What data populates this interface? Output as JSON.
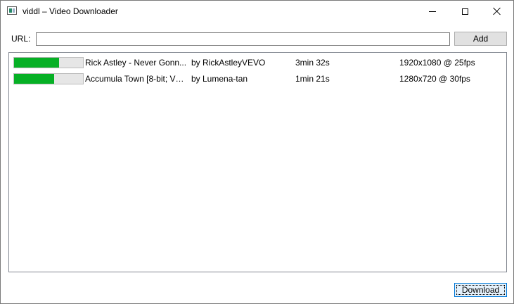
{
  "window": {
    "title": "viddl – Video Downloader",
    "icon": "app-window-icon"
  },
  "caption_buttons": {
    "minimize_icon": "minimize-icon",
    "maximize_icon": "maximize-icon",
    "close_icon": "close-icon"
  },
  "url_row": {
    "label": "URL:",
    "input_value": "",
    "input_placeholder": "",
    "add_label": "Add"
  },
  "videos": [
    {
      "title": "Rick Astley - Never Gonn...",
      "author": "by RickAstleyVEVO",
      "duration": "3min 32s",
      "format": "1920x1080 @ 25fps",
      "progress": 0.65
    },
    {
      "title": "Accumula Town [8-bit; VR...",
      "author": "by Lumena-tan",
      "duration": "1min 21s",
      "format": "1280x720 @ 30fps",
      "progress": 0.58
    }
  ],
  "footer": {
    "download_label": "Download"
  },
  "colors": {
    "progress_fill": "#06b025",
    "progress_track": "#e6e6e6",
    "focus_border": "#0078d7"
  }
}
